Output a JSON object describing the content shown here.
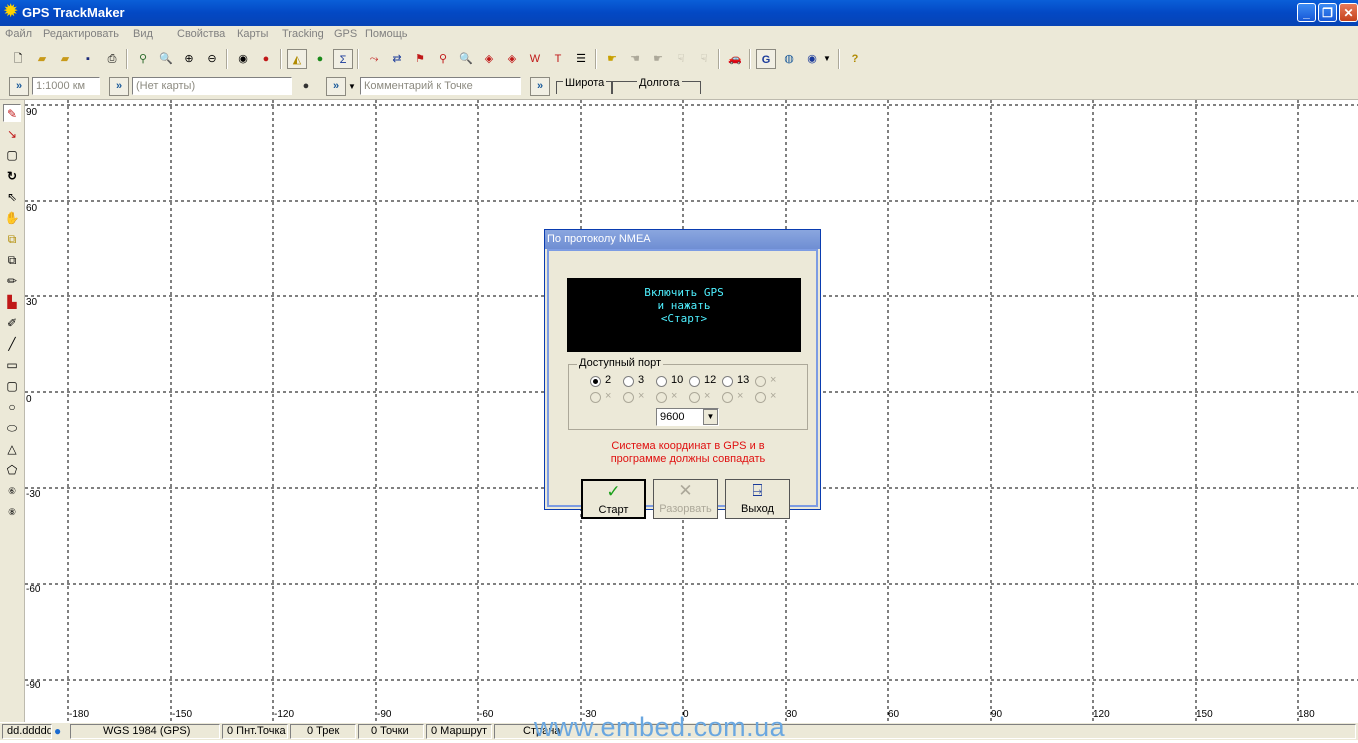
{
  "window": {
    "title": "GPS TrackMaker",
    "buttons": [
      "minimize",
      "maximize",
      "close"
    ]
  },
  "menu": [
    "Файл",
    "Редактировать",
    "Вид",
    "Свойства",
    "Карты",
    "Tracking",
    "GPS",
    "Помощь"
  ],
  "toolbar2": {
    "scale": "1:1000 км",
    "map_name": "(Нет карты)",
    "point_comment": "Комментарий к Точке",
    "latitude_label": "Широта",
    "longitude_label": "Долгота"
  },
  "map": {
    "y_labels": [
      "90",
      "60",
      "30",
      "0",
      "-30",
      "-60",
      "-90"
    ],
    "x_labels": [
      "-180",
      "-150",
      "-120",
      "-90",
      "-60",
      "-30",
      "0",
      "30",
      "60",
      "90",
      "120",
      "150",
      "180"
    ]
  },
  "dialog": {
    "title": "По протоколу NMEA",
    "screen_lines": [
      "Включить GPS",
      "и нажать",
      "<Старт>"
    ],
    "port_group_label": "Доступный порт",
    "ports_row1": [
      "2",
      "3",
      "10",
      "12",
      "13",
      "×"
    ],
    "ports_row2": [
      "×",
      "×",
      "×",
      "×",
      "×",
      "×"
    ],
    "selected_port": "2",
    "baud_rate": "9600",
    "warning_line1": "Система координат в GPS и в",
    "warning_line2": "программе должны совпадать",
    "buttons": {
      "start": "Старт",
      "abort": "Разорвать",
      "exit": "Выход"
    }
  },
  "status": {
    "coord_format": "dd.ddddd",
    "datum": "WGS 1984 (GPS)",
    "waypoints": "0 Пнт.Точка",
    "tracks": "0 Трек",
    "points": "0 Точки",
    "routes": "0 Маршрут",
    "country": "Страна"
  },
  "watermark": "www.embed.com.ua"
}
